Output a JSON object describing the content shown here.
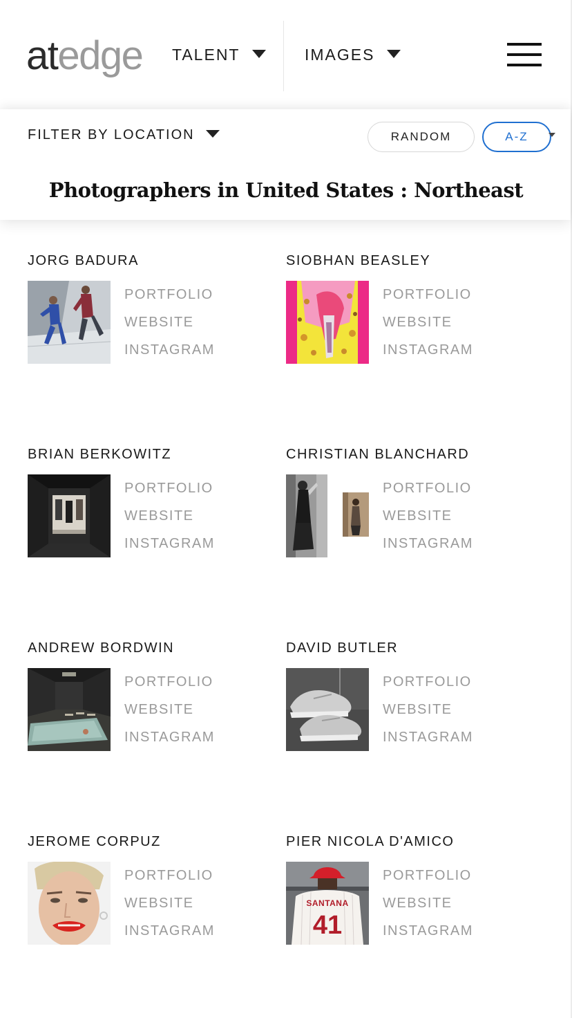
{
  "header": {
    "logo": {
      "part1": "at",
      "part2": "edge"
    },
    "nav": {
      "talent": "TALENT",
      "images": "IMAGES"
    }
  },
  "filter": {
    "location_label": "FILTER BY LOCATION",
    "sort_random": "RANDOM",
    "sort_az": "A-Z"
  },
  "page_title": "Photographers in United States : Northeast",
  "colors": {
    "accent": "#1f6fd0",
    "link": "#9a9a9a",
    "text": "#1a1a1a"
  },
  "photographers": [
    {
      "name": "JORG BADURA",
      "links": [
        "PORTFOLIO",
        "WEBSITE",
        "INSTAGRAM"
      ]
    },
    {
      "name": "SIOBHAN BEASLEY",
      "links": [
        "PORTFOLIO",
        "WEBSITE",
        "INSTAGRAM"
      ]
    },
    {
      "name": "BRIAN BERKOWITZ",
      "links": [
        "PORTFOLIO",
        "WEBSITE",
        "INSTAGRAM"
      ]
    },
    {
      "name": "CHRISTIAN BLANCHARD",
      "links": [
        "PORTFOLIO",
        "WEBSITE",
        "INSTAGRAM"
      ]
    },
    {
      "name": "ANDREW BORDWIN",
      "links": [
        "PORTFOLIO",
        "WEBSITE",
        "INSTAGRAM"
      ]
    },
    {
      "name": "DAVID BUTLER",
      "links": [
        "PORTFOLIO",
        "WEBSITE",
        "INSTAGRAM"
      ]
    },
    {
      "name": "JEROME CORPUZ",
      "links": [
        "PORTFOLIO",
        "WEBSITE",
        "INSTAGRAM"
      ]
    },
    {
      "name": "PIER NICOLA D'AMICO",
      "links": [
        "PORTFOLIO",
        "WEBSITE",
        "INSTAGRAM"
      ],
      "thumb_text": {
        "jersey_name": "SANTANA",
        "jersey_number": "41"
      }
    }
  ]
}
